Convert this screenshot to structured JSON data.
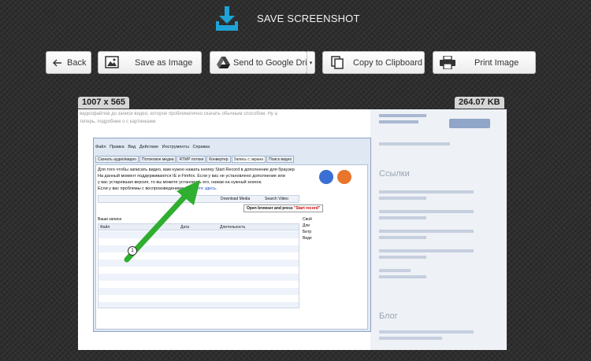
{
  "header": {
    "title": "SAVE SCREENSHOT",
    "icon": "download-icon",
    "accent_color": "#1fa3d6"
  },
  "toolbar": {
    "back_label": "Back",
    "save_label": "Save as Image",
    "drive_label": "Send to Google Drive",
    "drive_menu_icon": "chevron-down-icon",
    "copy_label": "Copy to Clipboard",
    "print_label": "Print Image"
  },
  "info": {
    "dimensions": "1007 x 565",
    "file_size": "264.07 KB"
  },
  "preview": {
    "top_text_1": "видеофайлов до записи видео, которое проблематично скачать обычным способом. Ну а",
    "top_text_2": "теперь, подробнее о с картинками.",
    "app_window": {
      "menu": [
        "Файл",
        "Правка",
        "Вид",
        "Действие",
        "Инструменты",
        "Справка"
      ],
      "tabs": [
        "Скачать аудио/видео",
        "Потоковое медиа",
        "RTMP потоки",
        "Конвертер",
        "Запись с экрана",
        "Поиск видео"
      ],
      "active_tab": "Запись с экрана",
      "lines": [
        "Для того чтобы записать видео, вам нужно нажать кнопку Start Record в дополнение для браузер",
        "На данный момент поддерживаются IE и Firefox. Если у вас не установлено дополнение или",
        "у вас устаревшая версия, то вы можете установить его, нажав на нужный значок.",
        "Если у вас проблемы с воспроизведением, "
      ],
      "help_link": "нажмите здесь.",
      "download_media": "Download Media",
      "search_video": "Search Video",
      "hint_text": "Open browser and press ",
      "hint_red": "\"Start record\"",
      "table_title": "Ваши записи",
      "table_columns": [
        "Файл",
        "Дата",
        "Длительность"
      ],
      "side_labels": [
        "Свой",
        "Дли",
        "Битр",
        "Виде"
      ],
      "marker_number": "1"
    },
    "sidebar": {
      "headings": [
        "Ссылки",
        "Блог"
      ]
    }
  }
}
